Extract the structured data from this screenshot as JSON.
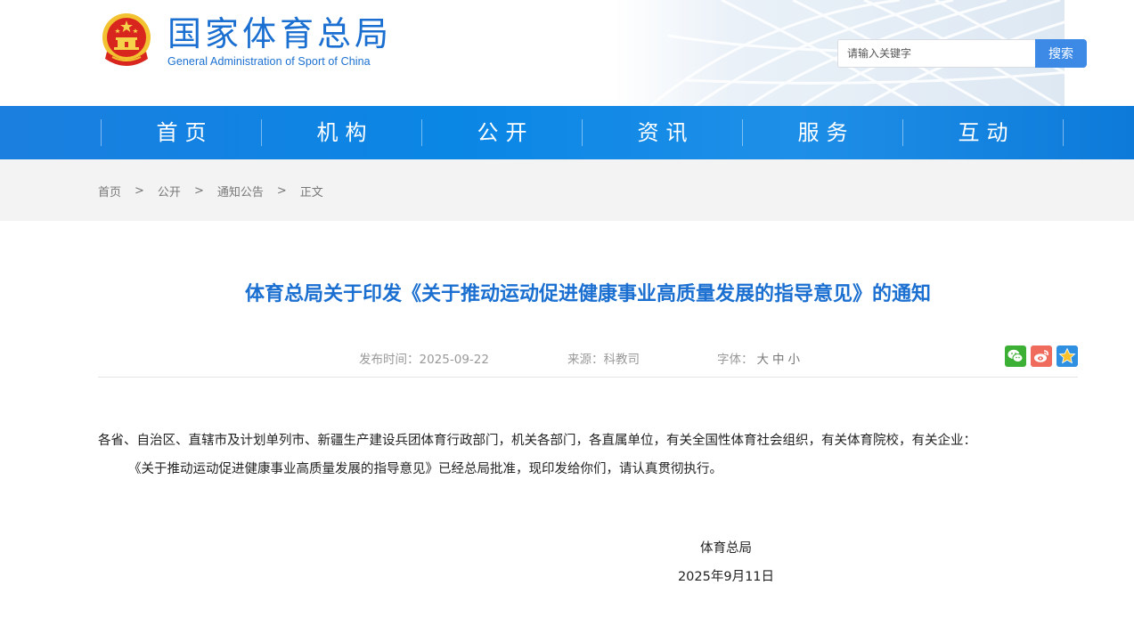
{
  "header": {
    "logo_cn": "国家体育总局",
    "logo_en": "General Administration of Sport of China",
    "search_placeholder": "请输入关键字",
    "search_button": "搜索"
  },
  "nav": {
    "items": [
      "首页",
      "机构",
      "公开",
      "资讯",
      "服务",
      "互动"
    ]
  },
  "breadcrumb": {
    "items": [
      "首页",
      "公开",
      "通知公告",
      "正文"
    ],
    "separator": ">"
  },
  "article": {
    "title": "体育总局关于印发《关于推动运动促进健康事业高质量发展的指导意见》的通知",
    "publish_label": "发布时间：",
    "publish_date": "2025-09-22",
    "source_label": "来源：",
    "source": "科教司",
    "font_label": "字体：",
    "font_sizes": [
      "大",
      "中",
      "小"
    ],
    "share_icons": [
      "wechat-icon",
      "weibo-icon",
      "favorite-icon"
    ],
    "recipients": "各省、自治区、直辖市及计划单列市、新疆生产建设兵团体育行政部门，机关各部门，各直属单位，有关全国性体育社会组织，有关体育院校，有关企业：",
    "paragraph": "《关于推动运动促进健康事业高质量发展的指导意见》已经总局批准，现印发给你们，请认真贯彻执行。",
    "signature": "体育总局",
    "sign_date": "2025年9月11日"
  },
  "colors": {
    "brand_blue": "#1a6fd0",
    "nav_blue": "#0a86e5",
    "search_button": "#3c8ae6",
    "breadcrumb_bg": "#f3f3f3"
  }
}
